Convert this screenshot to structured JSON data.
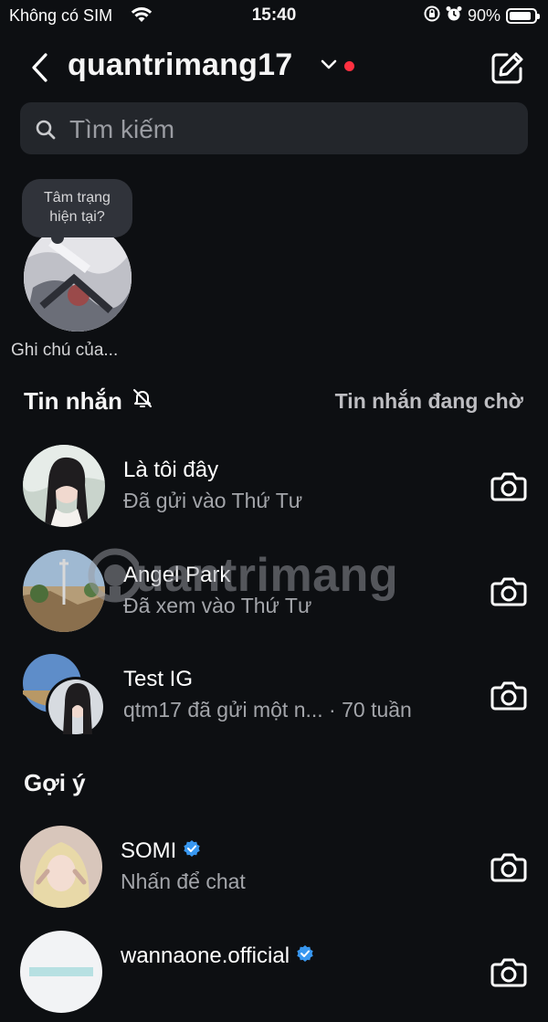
{
  "status_bar": {
    "carrier": "Không có SIM",
    "time": "15:40",
    "battery": "90%",
    "battery_level": 0.9
  },
  "header": {
    "title": "quantrimang17",
    "back_icon": "chevron-left-icon",
    "compose_icon": "compose-icon",
    "dot_color": "#ff3040"
  },
  "search": {
    "placeholder": "Tìm kiếm",
    "value": ""
  },
  "note": {
    "bubble_line1": "Tâm trạng",
    "bubble_line2": "hiện tại?",
    "label": "Ghi chú của..."
  },
  "messages": {
    "title": "Tin nhắn",
    "muted_icon": "bell-off-icon",
    "requests_label": "Tin nhắn đang chờ",
    "items": [
      {
        "name": "Là tôi đây",
        "sub": "Đã gửi vào Thứ Tư"
      },
      {
        "name": "Angel Park",
        "sub": "Đã xem vào Thứ Tư"
      },
      {
        "name": "Test IG",
        "sub": "qtm17 đã gửi một n...  · 70 tuần"
      }
    ]
  },
  "suggestions": {
    "title": "Gợi ý",
    "items": [
      {
        "name": "SOMI",
        "sub": "Nhấn để chat",
        "verified": true
      },
      {
        "name": "wannaone.official",
        "sub": "",
        "verified": true
      }
    ]
  },
  "watermark": {
    "text": "uantrimang"
  },
  "colors": {
    "background": "#0d0f12",
    "verified": "#3897f0",
    "accent_dot": "#ff3040"
  }
}
